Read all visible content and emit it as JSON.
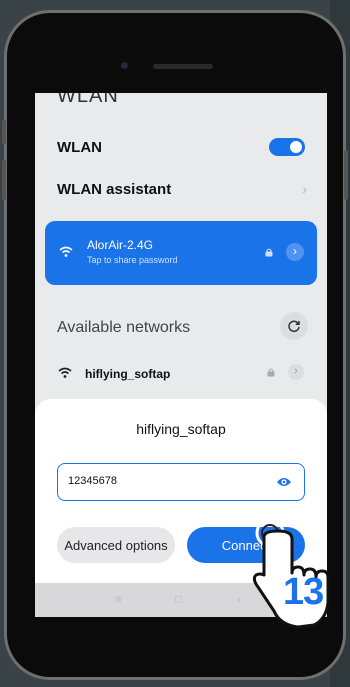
{
  "header": {
    "title_clipped": "WLAN"
  },
  "settings": {
    "wlan_label": "WLAN",
    "wlan_enabled": true,
    "assistant_label": "WLAN assistant"
  },
  "connected": {
    "ssid": "AlorAir-2.4G",
    "subtitle": "Tap to share password"
  },
  "available": {
    "heading": "Available networks",
    "networks": [
      {
        "ssid": "hiflying_softap",
        "locked": true
      }
    ]
  },
  "dialog": {
    "title": "hiflying_softap",
    "password_value": "12345678",
    "advanced_label": "Advanced options",
    "connect_label": "Connect"
  },
  "overlay": {
    "step_number": "13"
  },
  "colors": {
    "accent": "#1a73e8"
  }
}
